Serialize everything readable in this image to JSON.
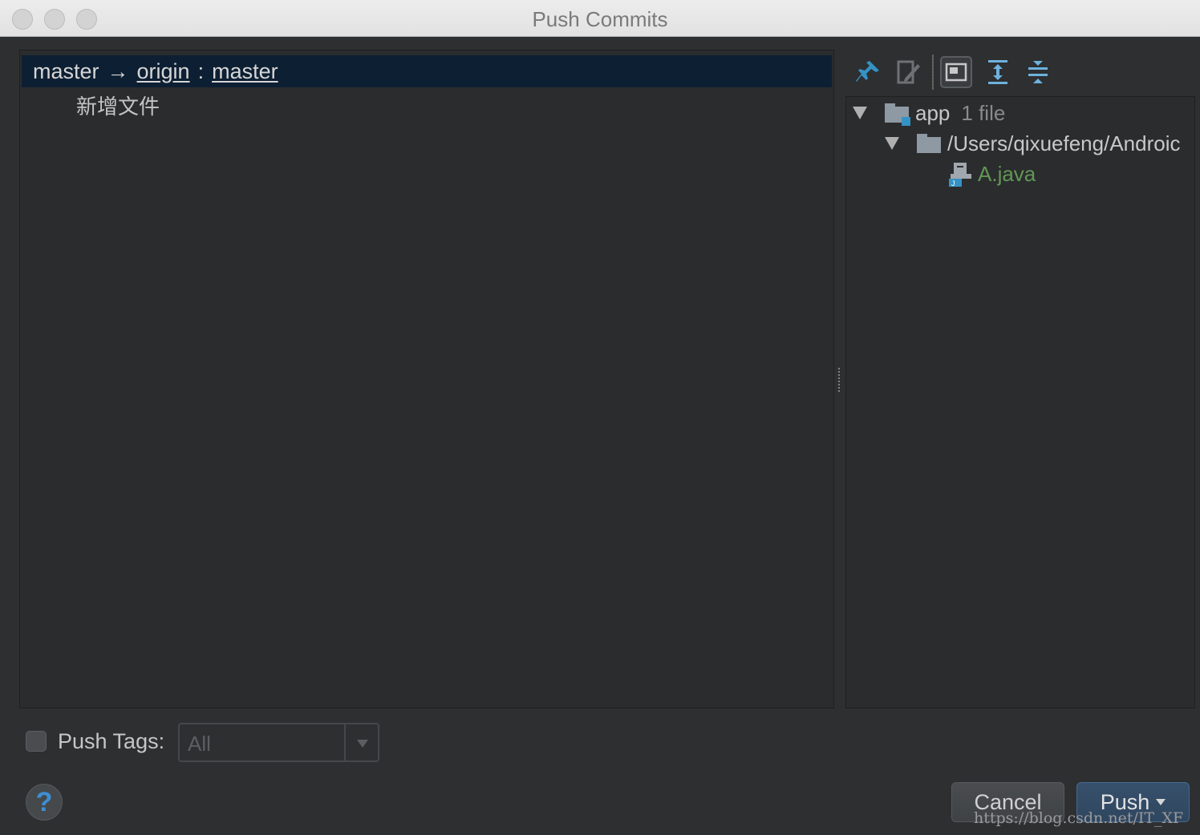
{
  "window": {
    "title": "Push Commits"
  },
  "commits": {
    "branch": {
      "local": "master",
      "arrow": "→",
      "remote": "origin",
      "separator": ":",
      "remote_branch": "master"
    },
    "items": [
      {
        "message": "新增文件"
      }
    ]
  },
  "toolbar": {
    "icons": [
      "pin-icon",
      "edit-source-icon",
      "group-by-module-icon",
      "expand-all-icon",
      "collapse-all-icon"
    ]
  },
  "changes": {
    "module": {
      "name": "app",
      "count": "1 file"
    },
    "directory": {
      "path": "/Users/qixuefeng/Androic"
    },
    "file": {
      "name": "A.java",
      "color": "#629755"
    }
  },
  "push_tags": {
    "label": "Push Tags:",
    "value": "All"
  },
  "help": {
    "glyph": "?"
  },
  "buttons": {
    "cancel": "Cancel",
    "push": "Push"
  },
  "watermark": "https://blog.csdn.net/IT_XF",
  "colors": {
    "selection": "#0d1f33",
    "accent": "#3592c4",
    "background": "#2d2f31"
  }
}
